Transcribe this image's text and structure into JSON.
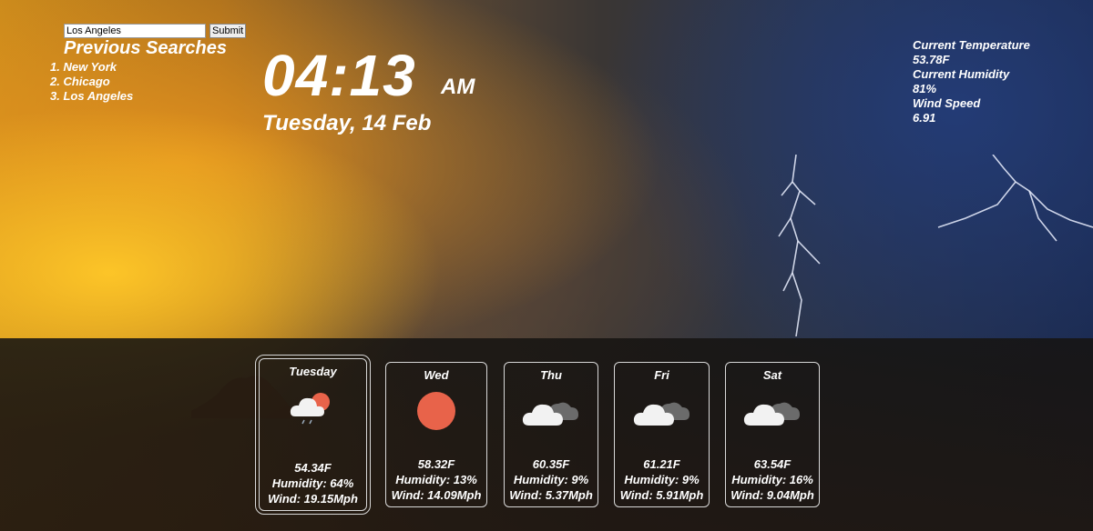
{
  "search": {
    "value": "Los Angeles",
    "submit_label": "Submit"
  },
  "previous_searches": {
    "title": "Previous Searches",
    "items": [
      "1. New York",
      "2. Chicago",
      "3. Los Angeles"
    ]
  },
  "clock": {
    "time": "04:13",
    "ampm": "AM",
    "date": "Tuesday, 14 Feb"
  },
  "current": {
    "temp_label": "Current Temperature",
    "temp_value": "53.78F",
    "humidity_label": "Current Humidity",
    "humidity_value": "81%",
    "wind_label": "Wind Speed",
    "wind_value": "6.91"
  },
  "forecast": [
    {
      "day": "Tuesday",
      "icon": "sun-cloud-rain-icon",
      "temp": "54.34F",
      "humidity": "Humidity: 64%",
      "wind": "Wind: 19.15Mph"
    },
    {
      "day": "Wed",
      "icon": "sun-icon",
      "temp": "58.32F",
      "humidity": "Humidity: 13%",
      "wind": "Wind: 14.09Mph"
    },
    {
      "day": "Thu",
      "icon": "cloud-icon",
      "temp": "60.35F",
      "humidity": "Humidity: 9%",
      "wind": "Wind: 5.37Mph"
    },
    {
      "day": "Fri",
      "icon": "cloud-icon",
      "temp": "61.21F",
      "humidity": "Humidity: 9%",
      "wind": "Wind: 5.91Mph"
    },
    {
      "day": "Sat",
      "icon": "cloud-icon",
      "temp": "63.54F",
      "humidity": "Humidity: 16%",
      "wind": "Wind: 9.04Mph"
    }
  ],
  "colors": {
    "sun": "#e8634a",
    "cloud": "#f2f2f2",
    "cloud_dark": "#6b6b6b",
    "card_border": "#d8d8d8"
  }
}
